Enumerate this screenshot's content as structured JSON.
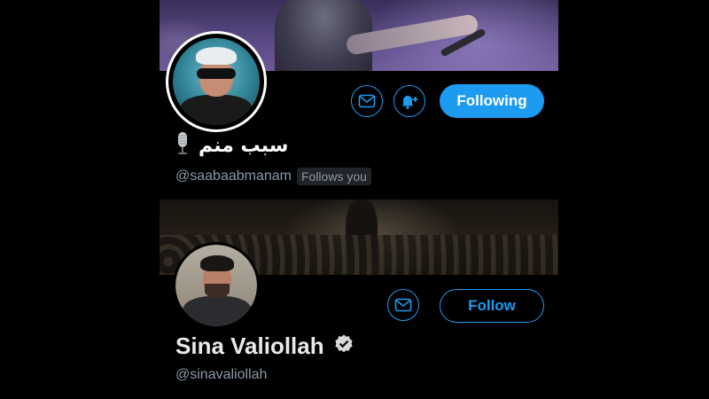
{
  "accent_color": "#1d9bf0",
  "profile_1": {
    "display_name": "سبب منم",
    "name_emoji_icon": "microphone-icon",
    "handle": "@saabaabmanam",
    "follows_you_badge": "Follows you",
    "message_icon": "envelope-icon",
    "notify_icon": "bell-plus-icon",
    "follow_button_label": "Following"
  },
  "profile_2": {
    "display_name": "Sina Valiollah",
    "verified_icon": "verified-badge-icon",
    "handle": "@sinavaliollah",
    "message_icon": "envelope-icon",
    "follow_button_label": "Follow"
  }
}
